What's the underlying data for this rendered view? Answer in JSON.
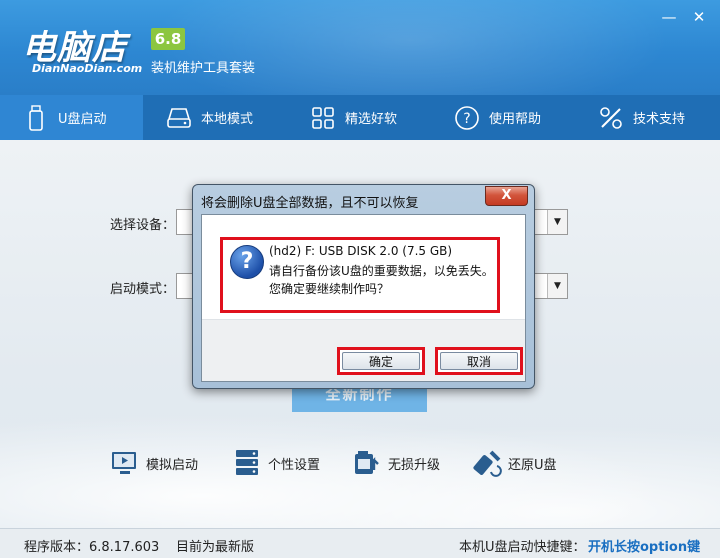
{
  "app": {
    "logo_text": "电脑店",
    "logo_sub": "DianNaoDian.com",
    "version": "6.8",
    "tagline": "装机维护工具套装",
    "minimize_glyph": "—",
    "close_glyph": "✕"
  },
  "nav": {
    "items": [
      {
        "label": "U盘启动",
        "icon": "usb-drive-icon",
        "active": true
      },
      {
        "label": "本地模式",
        "icon": "hard-disk-icon",
        "active": false
      },
      {
        "label": "精选好软",
        "icon": "apps-grid-icon",
        "active": false
      },
      {
        "label": "使用帮助",
        "icon": "help-circle-icon",
        "active": false
      },
      {
        "label": "技术支持",
        "icon": "tools-icon",
        "active": false
      }
    ]
  },
  "form": {
    "device_label": "选择设备：",
    "boot_mode_label": "启动模式：",
    "start_button": "全新制作"
  },
  "tools": [
    {
      "label": "模拟启动",
      "icon": "monitor-simulate-icon"
    },
    {
      "label": "个性设置",
      "icon": "server-settings-icon"
    },
    {
      "label": "无损升级",
      "icon": "upgrade-icon"
    },
    {
      "label": "还原U盘",
      "icon": "restore-usb-icon"
    }
  ],
  "footer": {
    "program_version": "程序版本：6.8.17.603",
    "update_status": "目前为最新版",
    "hotkey_label": "本机U盘启动快捷键：",
    "hotkey_value": "开机长按option键"
  },
  "dialog": {
    "title": "将会删除U盘全部数据，且不可以恢复",
    "close_glyph": "X",
    "icon_glyph": "?",
    "line1": "(hd2) F: USB DISK 2.0 (7.5 GB)",
    "line2": "请自行备份该U盘的重要数据，以免丢失。",
    "line3": "您确定要继续制作吗？",
    "confirm": "确定",
    "cancel": "取消"
  },
  "colors": {
    "header": "#2d87d2",
    "nav": "#1f6eb5",
    "nav_active": "#2f86d3",
    "version_badge": "#8cc63f",
    "highlight": "#e0101c",
    "hotkey": "#1a6fc1"
  }
}
